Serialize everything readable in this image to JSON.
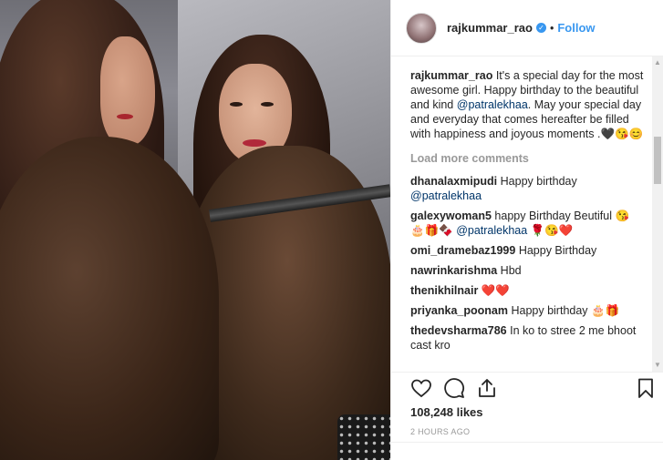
{
  "header": {
    "username": "rajkummar_rao",
    "verified": "✓",
    "separator": "•",
    "follow_label": "Follow"
  },
  "caption": {
    "username": "rajkummar_rao",
    "text_before": "It's a special day for the most awesome girl. Happy birthday to the beautiful and kind",
    "mention": "@patralekhaa",
    "text_after": ". May your special day and everyday that comes hereafter be filled with happiness and joyous moments .🖤😘😊"
  },
  "load_more": "Load more comments",
  "comments": [
    {
      "user": "dhanalaxmipudi",
      "text": "Happy birthday",
      "mention": "@patralekhaa",
      "after": ""
    },
    {
      "user": "galexywoman5",
      "text": "happy Birthday Beutiful 😘 🎂🎁🍫",
      "mention": "@patralekhaa",
      "after": "🌹😘❤️"
    },
    {
      "user": "omi_dramebaz1999",
      "text": "Happy Birthday",
      "mention": "",
      "after": ""
    },
    {
      "user": "nawrinkarishma",
      "text": "Hbd",
      "mention": "",
      "after": ""
    },
    {
      "user": "thenikhilnair",
      "text": "❤️❤️",
      "mention": "",
      "after": ""
    },
    {
      "user": "priyanka_poonam",
      "text": "Happy birthday 🎂🎁",
      "mention": "",
      "after": ""
    },
    {
      "user": "thedevsharma786",
      "text": "In ko to stree 2 me bhoot cast kro",
      "mention": "",
      "after": ""
    }
  ],
  "actions": {
    "like_icon": "heart-outline-icon",
    "comment_icon": "comment-bubble-icon",
    "share_icon": "share-icon",
    "save_icon": "bookmark-icon"
  },
  "likes": "108,248 likes",
  "timestamp": "2 HOURS AGO",
  "colors": {
    "accent": "#3897f0",
    "text": "#262626",
    "muted": "#999999",
    "mention": "#003569"
  }
}
